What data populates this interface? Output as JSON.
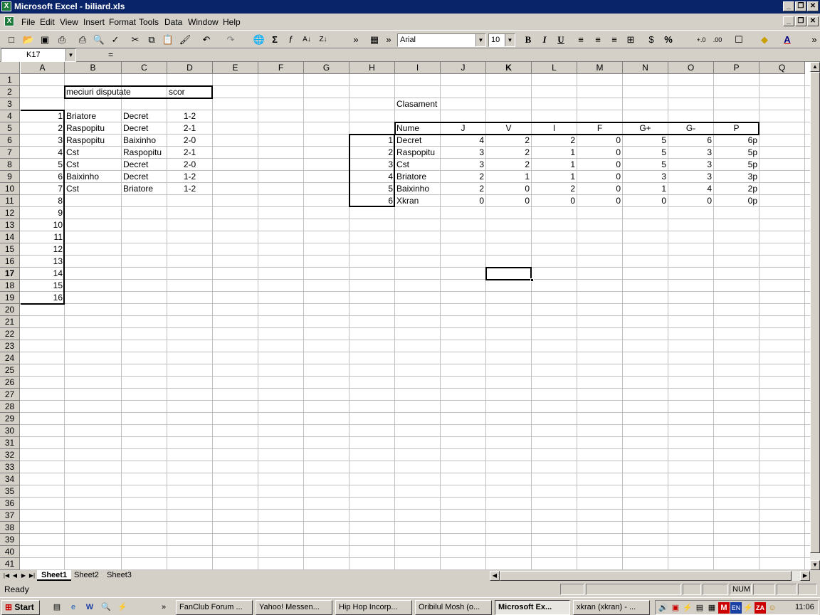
{
  "window": {
    "title": "Microsoft Excel - biliard.xls"
  },
  "menu": [
    "File",
    "Edit",
    "View",
    "Insert",
    "Format",
    "Tools",
    "Data",
    "Window",
    "Help"
  ],
  "toolbar": {
    "font": "Arial",
    "size": "10",
    "bold": "B",
    "italic": "I",
    "underline": "U",
    "percent": "%",
    "sigma": "Σ",
    "fx": "f",
    "more1": "»",
    "more2": "»"
  },
  "formula": {
    "namebox": "K17",
    "eq": "=",
    "content": ""
  },
  "columns": [
    "A",
    "B",
    "C",
    "D",
    "E",
    "F",
    "G",
    "H",
    "I",
    "J",
    "K",
    "L",
    "M",
    "N",
    "O",
    "P",
    "Q"
  ],
  "rows": [
    "1",
    "2",
    "3",
    "4",
    "5",
    "6",
    "7",
    "8",
    "9",
    "10",
    "11",
    "12",
    "13",
    "14",
    "15",
    "16",
    "17",
    "18",
    "19",
    "20",
    "21",
    "22",
    "23",
    "24",
    "25",
    "26",
    "27",
    "28",
    "29",
    "30",
    "31",
    "32",
    "33",
    "34",
    "35",
    "36",
    "37",
    "38",
    "39",
    "40",
    "41"
  ],
  "left_table": {
    "header_b": "meciuri disputate",
    "header_d": "scor",
    "numbers": [
      "1",
      "2",
      "3",
      "4",
      "5",
      "6",
      "7",
      "8",
      "9",
      "10",
      "11",
      "12",
      "13",
      "14",
      "15",
      "16"
    ],
    "matches": [
      [
        "Briatore",
        "Decret",
        "1-2"
      ],
      [
        "Raspopitu",
        "Decret",
        "2-1"
      ],
      [
        "Raspopitu",
        "Baixinho",
        "2-0"
      ],
      [
        "Cst",
        "Raspopitu",
        "2-1"
      ],
      [
        "Cst",
        "Decret",
        "2-0"
      ],
      [
        "Baixinho",
        "Decret",
        "1-2"
      ],
      [
        "Cst",
        "Briatore",
        "1-2"
      ]
    ]
  },
  "standings": {
    "title": "Clasament",
    "headers": [
      "Nume",
      "J",
      "V",
      "I",
      "F",
      "G+",
      "G-",
      "P"
    ],
    "ranks": [
      "1",
      "2",
      "3",
      "4",
      "5",
      "6"
    ],
    "rows": [
      [
        "Decret",
        "4",
        "2",
        "2",
        "0",
        "5",
        "6",
        "6p"
      ],
      [
        "Raspopitu",
        "3",
        "2",
        "1",
        "0",
        "5",
        "3",
        "5p"
      ],
      [
        "Cst",
        "3",
        "2",
        "1",
        "0",
        "5",
        "3",
        "5p"
      ],
      [
        "Briatore",
        "2",
        "1",
        "1",
        "0",
        "3",
        "3",
        "3p"
      ],
      [
        "Baixinho",
        "2",
        "0",
        "2",
        "0",
        "1",
        "4",
        "2p"
      ],
      [
        "Xkran",
        "0",
        "0",
        "0",
        "0",
        "0",
        "0",
        "0p"
      ]
    ]
  },
  "sheets": [
    "Sheet1",
    "Sheet2",
    "Sheet3"
  ],
  "status": {
    "ready": "Ready",
    "num": "NUM"
  },
  "taskbar": {
    "start": "Start",
    "more": "»",
    "tasks": [
      "FanClub Forum ...",
      "Yahoo! Messen...",
      "Hip Hop Incorp...",
      "Oribilul Mosh  (o...",
      "Microsoft Ex...",
      "xkran  (xkran) - ..."
    ],
    "clock": "11:06"
  }
}
